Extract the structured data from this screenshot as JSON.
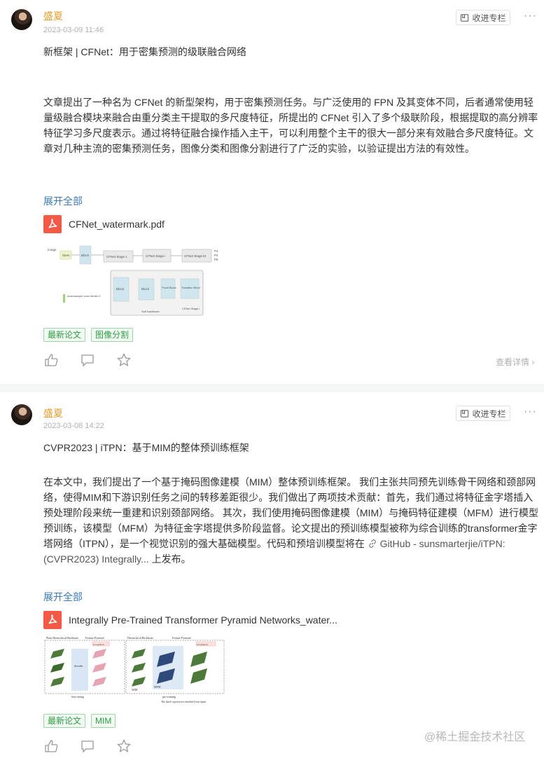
{
  "posts": [
    {
      "author": "盛夏",
      "date": "2023-03-09 11:46",
      "collect_label": "收进专栏",
      "title": "新框架 | CFNet：用于密集预测的级联融合网络",
      "body": "文章提出了一种名为 CFNet 的新型架构，用于密集预测任务。与广泛使用的 FPN 及其变体不同，后者通常使用轻量级融合模块来融合由重分类主干提取的多尺度特征，所提出的 CFNet 引入了多个级联阶段，根据提取的高分辨率特征学习多尺度表示。通过将特征融合操作插入主干，可以利用整个主干的很大一部分来有效融合多尺度特征。文章对几种主流的密集预测任务，图像分类和图像分割进行了广泛的实验，以验证提出方法的有效性。",
      "expand_label": "展开全部",
      "file_name": "CFNet_watermark.pdf",
      "diagram_labels": [
        "Image",
        "Stem",
        "Block",
        "CFNet Stage 1",
        "CFNet Stage i",
        "CFNet Stage M",
        "P3",
        "P4",
        "P5",
        "Block",
        "Block",
        "Focal Block",
        "Transition Block",
        "Sub backbone",
        "CFNet Stage i",
        "downsample conv stride=2"
      ],
      "tags": [
        "最新论文",
        "图像分割"
      ],
      "detail_label": "查看详情"
    },
    {
      "author": "盛夏",
      "date": "2023-03-08 14:22",
      "collect_label": "收进专栏",
      "title": "CVPR2023 | iTPN：基于MIM的整体预训练框架",
      "body_before": "在本文中，我们提出了一个基于掩码图像建模（MIM）整体预训练框架。 我们主张共同预先训练骨干网络和颈部网络，使得MIM和下游识别任务之间的转移差距很少。我们做出了两项技术贡献：首先，我们通过将特征金字塔插入预处理阶段来统一重建和识别颈部网络。 其次，我们使用掩码图像建模（MIM）与掩码特征建模（MFM）进行模型预训练，该模型（MFM）为特征金字塔提供多阶段监督。论文提出的预训练模型被称为综合训练的transformer金字塔网络（ITPN），是一个视觉识别的强大基础模型。代码和预培训模型将在 ",
      "link_text": "GitHub - sunsmarterjie/iTPN: (CVPR2023) Integrally...",
      "body_after": " 上发布。",
      "expand_label": "展开全部",
      "file_name": "Integrally Pre-Trained Transformer Pyramid Networks_water...",
      "diagram_labels": [
        "Plain Hierarchical Backbone",
        "Feature Pyramid",
        "Hierarchical Backbone",
        "Feature Pyramid",
        "recognition",
        "recognition",
        "decoder",
        "MFM",
        "MIM",
        "fine-tuning",
        "pre-training",
        "The dark regions are masked from input"
      ],
      "tags": [
        "最新论文",
        "MIM"
      ]
    }
  ],
  "watermark": "@稀土掘金技术社区",
  "icons": [
    "avatar",
    "bookmark-icon",
    "more-icon",
    "pdf-icon",
    "like-icon",
    "comment-icon",
    "star-icon",
    "chevron-right-icon",
    "link-icon"
  ]
}
